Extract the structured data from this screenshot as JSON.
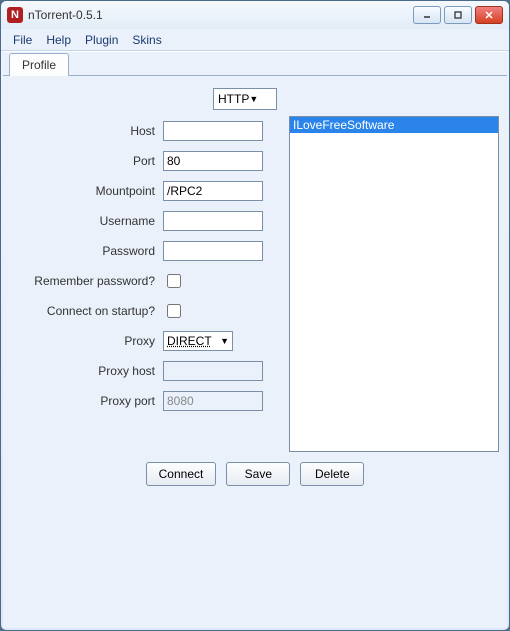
{
  "window": {
    "title": "nTorrent-0.5.1",
    "icon_letter": "N"
  },
  "menu": {
    "file": "File",
    "help": "Help",
    "plugin": "Plugin",
    "skins": "Skins"
  },
  "tabs": {
    "profile": "Profile"
  },
  "form": {
    "protocol": {
      "value": "HTTP"
    },
    "host": {
      "label": "Host",
      "value": ""
    },
    "port": {
      "label": "Port",
      "value": "80"
    },
    "mountpoint": {
      "label": "Mountpoint",
      "value": "/RPC2"
    },
    "username": {
      "label": "Username",
      "value": ""
    },
    "password": {
      "label": "Password",
      "value": ""
    },
    "remember": {
      "label": "Remember password?",
      "checked": false
    },
    "startup": {
      "label": "Connect on startup?",
      "checked": false
    },
    "proxy": {
      "label": "Proxy",
      "value": "DIRECT"
    },
    "proxy_host": {
      "label": "Proxy host",
      "value": ""
    },
    "proxy_port": {
      "label": "Proxy port",
      "value": "8080"
    }
  },
  "profiles": {
    "items": [
      "ILoveFreeSoftware"
    ]
  },
  "buttons": {
    "connect": "Connect",
    "save": "Save",
    "delete": "Delete"
  }
}
